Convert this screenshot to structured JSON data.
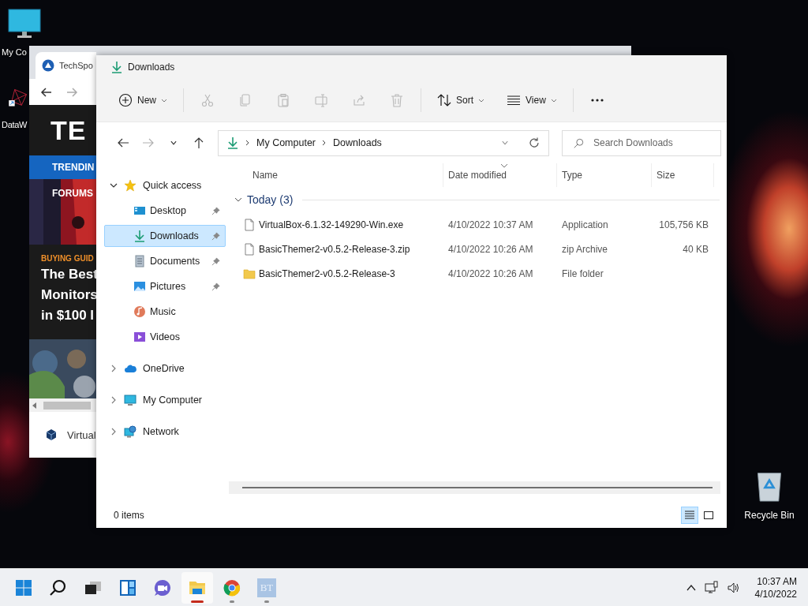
{
  "desktop_icons": [
    {
      "kind": "computer",
      "label": "My Co"
    },
    {
      "kind": "shortcut",
      "label": "DataW"
    },
    {
      "kind": "recycle-bin",
      "label": "Recycle Bin"
    }
  ],
  "browser": {
    "tab_title": "TechSpo",
    "site_logo": "TE",
    "nav_items": [
      "TRENDIN",
      "FORUMS"
    ],
    "article": {
      "category": "BUYING GUID",
      "headline_lines": [
        "The Best",
        "Monitors",
        "in $100 I"
      ]
    },
    "download_item": "Virtual"
  },
  "explorer": {
    "title": "Downloads",
    "toolbar": [
      {
        "kind": "new",
        "label": "New",
        "disabled": false
      },
      {
        "kind": "separator"
      },
      {
        "kind": "cut",
        "disabled": true
      },
      {
        "kind": "copy",
        "disabled": true
      },
      {
        "kind": "paste",
        "disabled": true
      },
      {
        "kind": "rename",
        "disabled": true
      },
      {
        "kind": "share",
        "disabled": true
      },
      {
        "kind": "delete",
        "disabled": true
      },
      {
        "kind": "separator"
      },
      {
        "kind": "sort",
        "label": "Sort",
        "disabled": false
      },
      {
        "kind": "view",
        "label": "View",
        "disabled": false
      },
      {
        "kind": "separator"
      },
      {
        "kind": "more",
        "disabled": false
      }
    ],
    "nav_buttons": [
      {
        "kind": "back",
        "disabled": false
      },
      {
        "kind": "forward",
        "disabled": true
      },
      {
        "kind": "recent",
        "disabled": false
      },
      {
        "kind": "up",
        "disabled": false
      }
    ],
    "breadcrumb": [
      "My Computer",
      "Downloads"
    ],
    "search": {
      "placeholder": "Search Downloads"
    },
    "sidebar": [
      {
        "kind": "star",
        "label": "Quick access",
        "expanded": true,
        "selected": false,
        "children": [
          {
            "kind": "desktop",
            "label": "Desktop",
            "pinned": true,
            "selected": false
          },
          {
            "kind": "downloads",
            "label": "Downloads",
            "pinned": true,
            "selected": true
          },
          {
            "kind": "documents",
            "label": "Documents",
            "pinned": true,
            "selected": false
          },
          {
            "kind": "pictures",
            "label": "Pictures",
            "pinned": true,
            "selected": false
          },
          {
            "kind": "music",
            "label": "Music",
            "pinned": false,
            "selected": false
          },
          {
            "kind": "videos",
            "label": "Videos",
            "pinned": false,
            "selected": false
          }
        ]
      },
      {
        "kind": "cloud",
        "label": "OneDrive",
        "expanded": false,
        "selected": false
      },
      {
        "kind": "computer",
        "label": "My Computer",
        "expanded": false,
        "selected": false
      },
      {
        "kind": "network",
        "label": "Network",
        "expanded": false,
        "selected": false
      }
    ],
    "columns": [
      {
        "label": "Name",
        "sorted": false
      },
      {
        "label": "Date modified",
        "sorted": true
      },
      {
        "label": "Type",
        "sorted": false
      },
      {
        "label": "Size",
        "sorted": false
      }
    ],
    "groups": [
      {
        "label": "Today (3)",
        "expanded": true,
        "rows": [
          {
            "kind": "file",
            "name": "VirtualBox-6.1.32-149290-Win.exe",
            "date": "4/10/2022 10:37 AM",
            "type": "Application",
            "size": "105,756 KB"
          },
          {
            "kind": "file",
            "name": "BasicThemer2-v0.5.2-Release-3.zip",
            "date": "4/10/2022 10:26 AM",
            "type": "zip Archive",
            "size": "40 KB"
          },
          {
            "kind": "folder",
            "name": "BasicThemer2-v0.5.2-Release-3",
            "date": "4/10/2022 10:26 AM",
            "type": "File folder"
          }
        ]
      }
    ],
    "status": "0 items",
    "view_modes": [
      {
        "kind": "details",
        "selected": true
      },
      {
        "kind": "tiles",
        "selected": false
      }
    ]
  },
  "taskbar": {
    "apps": [
      {
        "kind": "start",
        "running": false,
        "active": false
      },
      {
        "kind": "search",
        "running": false,
        "active": false
      },
      {
        "kind": "task-view",
        "running": false,
        "active": false
      },
      {
        "kind": "widgets",
        "running": false,
        "active": false
      },
      {
        "kind": "chat",
        "running": false,
        "active": false
      },
      {
        "kind": "explorer",
        "running": true,
        "active": true
      },
      {
        "kind": "chrome",
        "running": true,
        "active": false
      },
      {
        "kind": "text-tile",
        "icon_text": "BT",
        "running": true,
        "active": false
      }
    ],
    "clock": {
      "time": "10:37 AM",
      "date": "4/10/2022"
    }
  }
}
